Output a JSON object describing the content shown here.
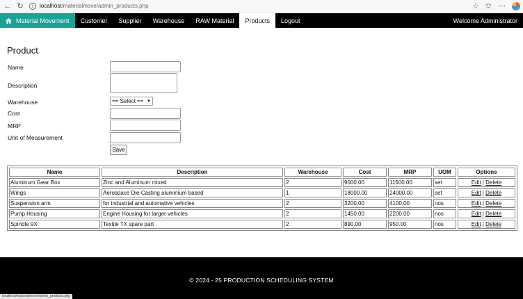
{
  "browser": {
    "url_host": "localhost",
    "url_path": "/materialmove/admin_products.php",
    "status_url": "localhost/materialmove/admin_products.php"
  },
  "navbar": {
    "brand": "Material Movement",
    "items": [
      "Customer",
      "Supplier",
      "Warehouse",
      "RAW Material",
      "Products",
      "Logout"
    ],
    "active": "Products",
    "welcome": "Welcome Administrator"
  },
  "form": {
    "title": "Product",
    "labels": {
      "name": "Name",
      "description": "Description",
      "warehouse": "Warehouse",
      "cost": "Cost",
      "mrp": "MRP",
      "uom": "Unit of Measurement"
    },
    "warehouse_select": "== Select ==",
    "save": "Save"
  },
  "table": {
    "headers": [
      "Name",
      "Description",
      "Warehouse",
      "Cost",
      "MRP",
      "UOM",
      "Options"
    ],
    "rows": [
      [
        "Aluminum Gear Box",
        "Zinc and Aluminum mixed",
        "2",
        "9000.00",
        "11500.00",
        "set"
      ],
      [
        "Wings",
        "Aerospace Die Casting aluminium based",
        "1",
        "18000.00",
        "24000.00",
        "set"
      ],
      [
        "Suspension arm",
        "for industrial and automative vehicles",
        "2",
        "3200.00",
        "4100.00",
        "nos"
      ],
      [
        "Pump Housing",
        "Engine Housing for larger vehicles",
        "2",
        "1450.00",
        "2200.00",
        "nos"
      ],
      [
        "Spindle 9X",
        "Textile TX spare part",
        "2",
        "890.00",
        "950.00",
        "nos"
      ]
    ],
    "edit_label": "Edit",
    "separator": "|",
    "delete_label": "Delete"
  },
  "footer": {
    "text": "© 2024 - 25 PRODUCTION SCHEDULING SYSTEM"
  },
  "colors": {
    "brand_bg": "#17a398",
    "navbar_bg": "#000000",
    "footer_bg": "#000000"
  }
}
